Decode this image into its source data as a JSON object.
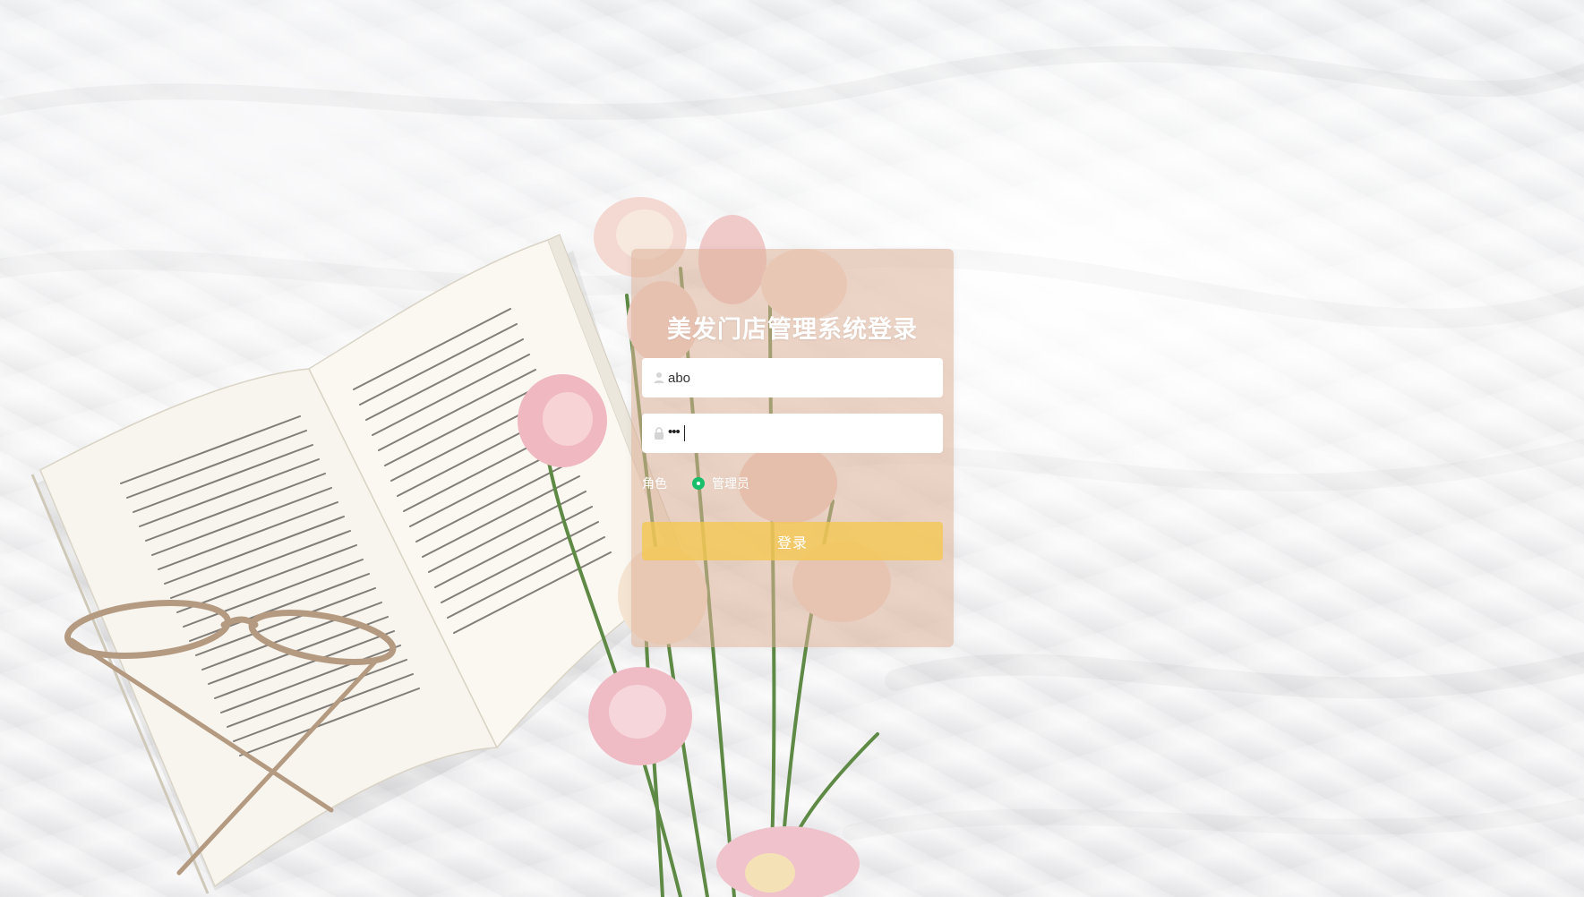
{
  "page": {
    "background_scene": "white bed sheets with an open book, glasses and pink flowers"
  },
  "login": {
    "title": "美发门店管理系统登录",
    "username_value": "abo",
    "password_mask": "•••",
    "role_label": "角色",
    "role_options": [
      "管理员"
    ],
    "role_selected": "管理员",
    "submit_label": "登录"
  },
  "icons": {
    "username": "user-icon",
    "password": "lock-icon"
  },
  "colors": {
    "card": "#ddb097",
    "button": "#f5c850",
    "radio_checked": "#19be6b",
    "text_on_card": "#ffffff"
  }
}
